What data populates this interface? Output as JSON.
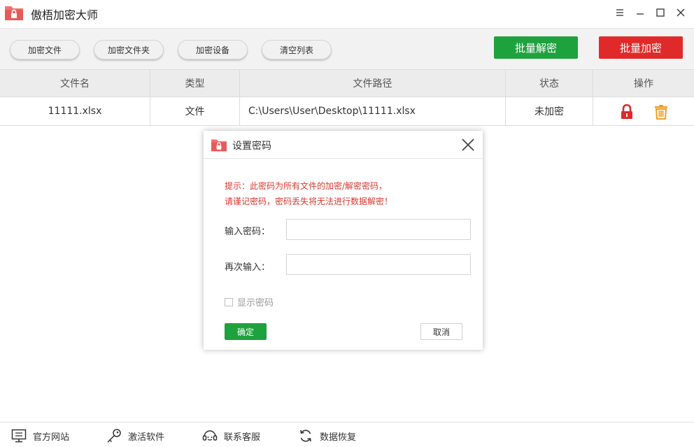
{
  "app": {
    "title": "傲梧加密大师"
  },
  "toolbar": {
    "buttons": [
      "加密文件",
      "加密文件夹",
      "加密设备",
      "清空列表"
    ],
    "batch_decrypt": "批量解密",
    "batch_encrypt": "批量加密",
    "colors": {
      "decrypt": "#1ea23e",
      "encrypt": "#e02a2a"
    }
  },
  "table": {
    "headers": [
      "文件名",
      "类型",
      "文件路径",
      "状态",
      "操作"
    ],
    "rows": [
      {
        "name": "11111.xlsx",
        "type": "文件",
        "path": "C:\\Users\\User\\Desktop\\11111.xlsx",
        "status": "未加密",
        "actions": [
          "lock-icon",
          "trash-icon"
        ]
      }
    ]
  },
  "dialog": {
    "title": "设置密码",
    "hint_line1": "提示：此密码为所有文件的加密/解密密码，",
    "hint_line2": "请谨记密码，密码丢失将无法进行数据解密！",
    "password_label": "输入密码：",
    "password_value": "",
    "confirm_label": "再次输入：",
    "confirm_value": "",
    "show_password_label": "显示密码",
    "show_password_checked": false,
    "ok_label": "确定",
    "cancel_label": "取消"
  },
  "footer": {
    "items": [
      {
        "label": "官方网站",
        "icon": "monitor-icon"
      },
      {
        "label": "激活软件",
        "icon": "key-icon"
      },
      {
        "label": "联系客服",
        "icon": "headset-icon"
      },
      {
        "label": "数据恢复",
        "icon": "refresh-icon"
      }
    ]
  }
}
